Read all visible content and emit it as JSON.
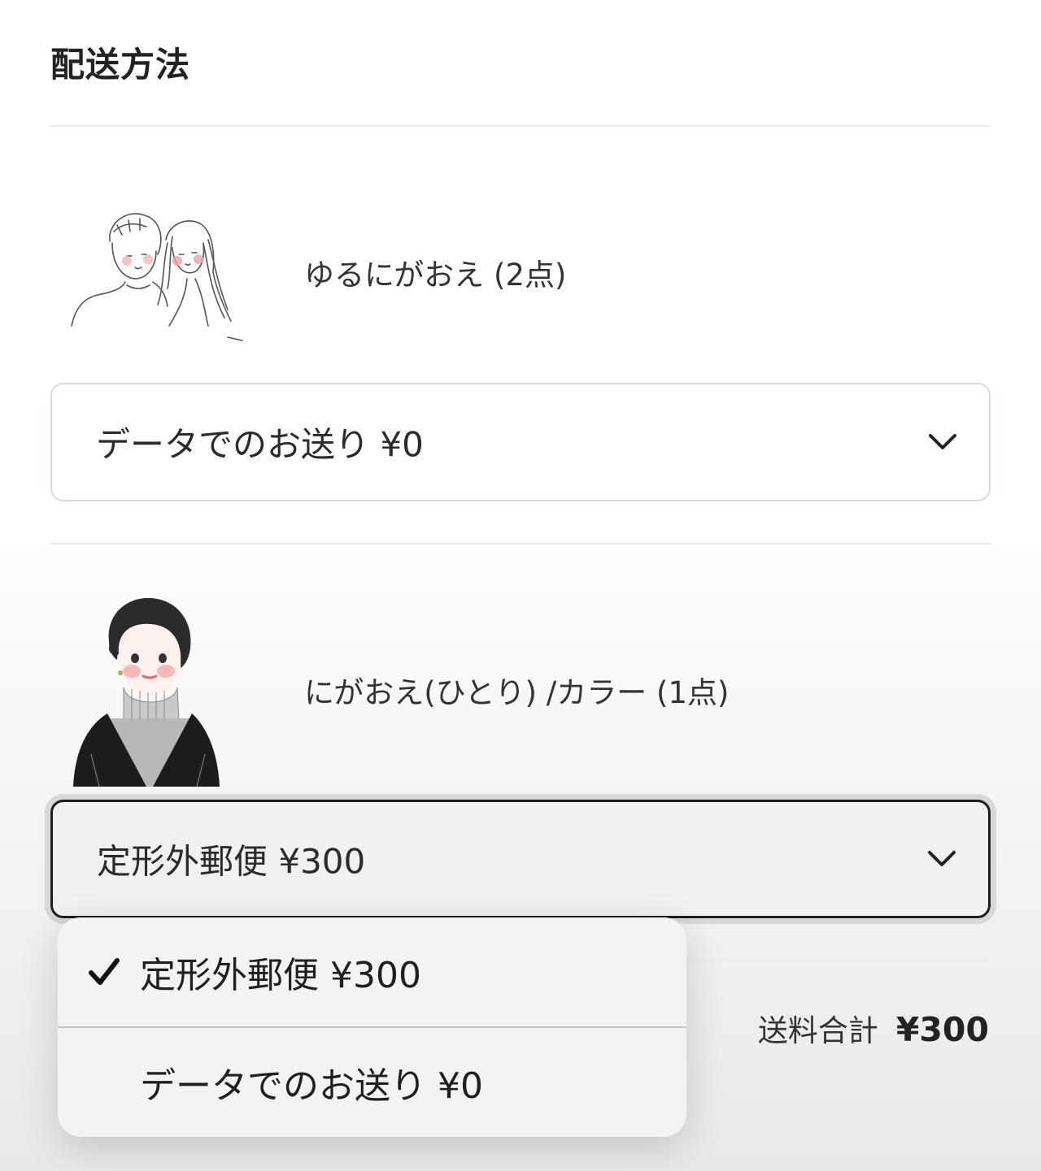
{
  "section": {
    "title": "配送方法"
  },
  "items": [
    {
      "product_name": "ゆるにがおえ (2点)",
      "shipping_selected": "データでのお送り ¥0"
    },
    {
      "product_name": "にがおえ(ひとり) /カラー (1点)",
      "shipping_selected": "定形外郵便 ¥300"
    }
  ],
  "dropdown": {
    "options": [
      {
        "label": "定形外郵便 ¥300",
        "checked": true
      },
      {
        "label": "データでのお送り ¥0",
        "checked": false
      }
    ]
  },
  "summary": {
    "shipping_total_label": "送料合計",
    "shipping_total_value": "¥300"
  },
  "icons": {
    "chevron": "chevron-down-icon",
    "check": "checkmark-icon"
  },
  "colors": {
    "focus_border": "#1e1e1e",
    "select_border": "#d5dbe6"
  }
}
